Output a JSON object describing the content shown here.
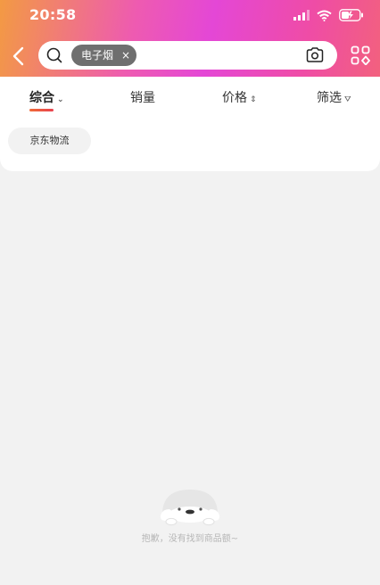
{
  "status_bar": {
    "time": "20:58",
    "icons": [
      "cellular-signal-icon",
      "wifi-icon",
      "battery-charging-icon"
    ]
  },
  "search": {
    "tag_label": "电子烟",
    "tag_close": "×",
    "icons": [
      "back-arrow-icon",
      "search-icon",
      "camera-icon",
      "grid-icon"
    ]
  },
  "sort_tabs": [
    {
      "label": "综合",
      "arrow": "⌄",
      "active": true
    },
    {
      "label": "销量",
      "arrow": "",
      "active": false
    },
    {
      "label": "价格",
      "arrow": "⇕",
      "active": false
    },
    {
      "label": "筛选",
      "arrow": "⛛",
      "active": false
    }
  ],
  "filters": {
    "logistics_label": "京东物流"
  },
  "empty_state": {
    "message": "抱歉，没有找到商品额~"
  },
  "colors": {
    "header_gradient": [
      "#f39a43",
      "#ee5bb0",
      "#e447d6",
      "#f2617e"
    ],
    "active_underline": "#f06a37",
    "background": "#f2f2f2"
  }
}
